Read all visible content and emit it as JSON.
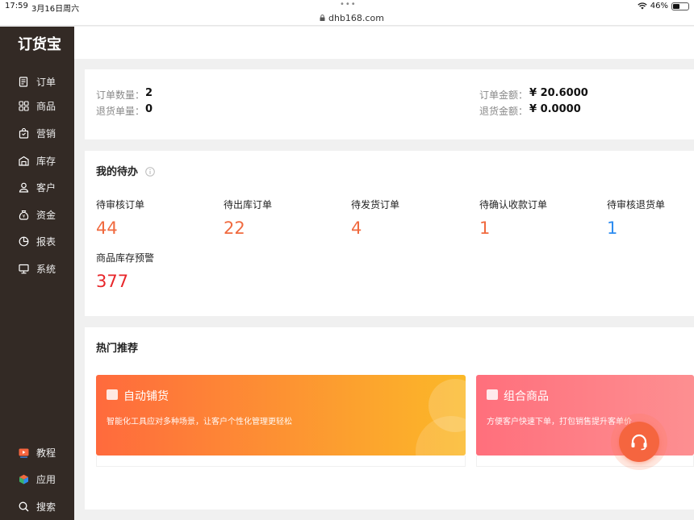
{
  "status_bar": {
    "time": "17:59",
    "date": "3月16日周六",
    "url": "dhb168.com",
    "battery": "46%",
    "battery_level": 0.46
  },
  "sidebar": {
    "logo": "订货宝",
    "items": [
      {
        "label": "订单",
        "icon": "order-icon"
      },
      {
        "label": "商品",
        "icon": "grid-icon"
      },
      {
        "label": "营销",
        "icon": "bag-icon"
      },
      {
        "label": "库存",
        "icon": "warehouse-icon"
      },
      {
        "label": "客户",
        "icon": "user-icon"
      },
      {
        "label": "资金",
        "icon": "money-bag-icon"
      },
      {
        "label": "报表",
        "icon": "pie-chart-icon"
      },
      {
        "label": "系统",
        "icon": "monitor-icon"
      }
    ],
    "bottom_items": [
      {
        "label": "教程",
        "icon": "video-icon"
      },
      {
        "label": "应用",
        "icon": "cube-icon"
      },
      {
        "label": "搜索",
        "icon": "search-icon"
      }
    ]
  },
  "summary": {
    "order_count_label": "订单数量：",
    "order_count": "2",
    "return_count_label": "退货单量：",
    "return_count": "0",
    "order_amount_label": "订单金额：",
    "order_amount": "¥ 20.6000",
    "return_amount_label": "退货金额：",
    "return_amount": "¥ 0.0000"
  },
  "todo": {
    "title": "我的待办",
    "items": [
      {
        "label": "待审核订单",
        "value": "44",
        "color": "#f06a3f"
      },
      {
        "label": "待出库订单",
        "value": "22",
        "color": "#f06a3f"
      },
      {
        "label": "待发货订单",
        "value": "4",
        "color": "#f06a3f"
      },
      {
        "label": "待确认收款订单",
        "value": "1",
        "color": "#f06a3f"
      },
      {
        "label": "待审核退货单",
        "value": "1",
        "color": "#2d8cf0"
      },
      {
        "label": "商品库存预警",
        "value": "377",
        "color": "#e8262a"
      }
    ]
  },
  "hot": {
    "title": "热门推荐",
    "cards": [
      {
        "title": "自动铺货",
        "desc": "智能化工具应对多种场景，让客户个性化管理更轻松",
        "gradient_from": "#ff6a3d",
        "gradient_to": "#fbb928"
      },
      {
        "title": "组合商品",
        "desc": "方便客户快速下单，打包销售提升客单价",
        "gradient_from": "#ff6f7c",
        "gradient_to": "#fd8f91"
      }
    ]
  },
  "colors": {
    "sidebar_bg": "#332a25",
    "accent": "#f5653f"
  }
}
